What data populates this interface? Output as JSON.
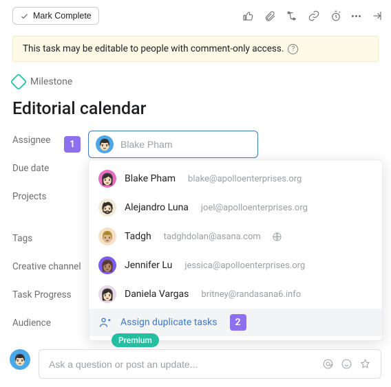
{
  "toolbar": {
    "mark_complete": "Mark Complete"
  },
  "notice": {
    "text": "This task may be editable to people with comment-only access."
  },
  "milestone_label": "Milestone",
  "title": "Editorial calendar",
  "fields": {
    "assignee": "Assignee",
    "due_date": "Due date",
    "projects": "Projects",
    "tags": "Tags",
    "creative_channel": "Creative channel",
    "task_progress": "Task Progress",
    "audience": "Audience"
  },
  "callouts": {
    "one": "1",
    "two": "2"
  },
  "assign_input": {
    "placeholder": "Blake Pham"
  },
  "suggestions": [
    {
      "name": "Blake Pham",
      "email": "blake@apolloenterprises.org",
      "avatar_bg": "#e66dc2",
      "emoji": "👩🏻"
    },
    {
      "name": "Alejandro Luna",
      "email": "joel@apolloenterprises.org",
      "avatar_bg": "#f0ead6",
      "emoji": "🧔🏻"
    },
    {
      "name": "Tadgh",
      "email": "tadghdolan@asana.com",
      "avatar_bg": "#f5e0c8",
      "emoji": "👨🏼",
      "globe": true
    },
    {
      "name": "Jennifer Lu",
      "email": "jessica@apolloenterprises.org",
      "avatar_bg": "#7b5cf0",
      "emoji": "👩🏽"
    },
    {
      "name": "Daniela Vargas",
      "email": "britney@randasana6.info",
      "avatar_bg": "#e8d9e8",
      "emoji": "👩🏻"
    }
  ],
  "assign_duplicate": "Assign duplicate tasks",
  "premium": "Premium",
  "comment": {
    "placeholder": "Ask a question or post an update..."
  },
  "current_user": {
    "avatar_bg": "#4aa7e8",
    "emoji": "👨🏻"
  },
  "input_avatar": {
    "bg": "#4aa7e8",
    "emoji": "👨🏻"
  }
}
